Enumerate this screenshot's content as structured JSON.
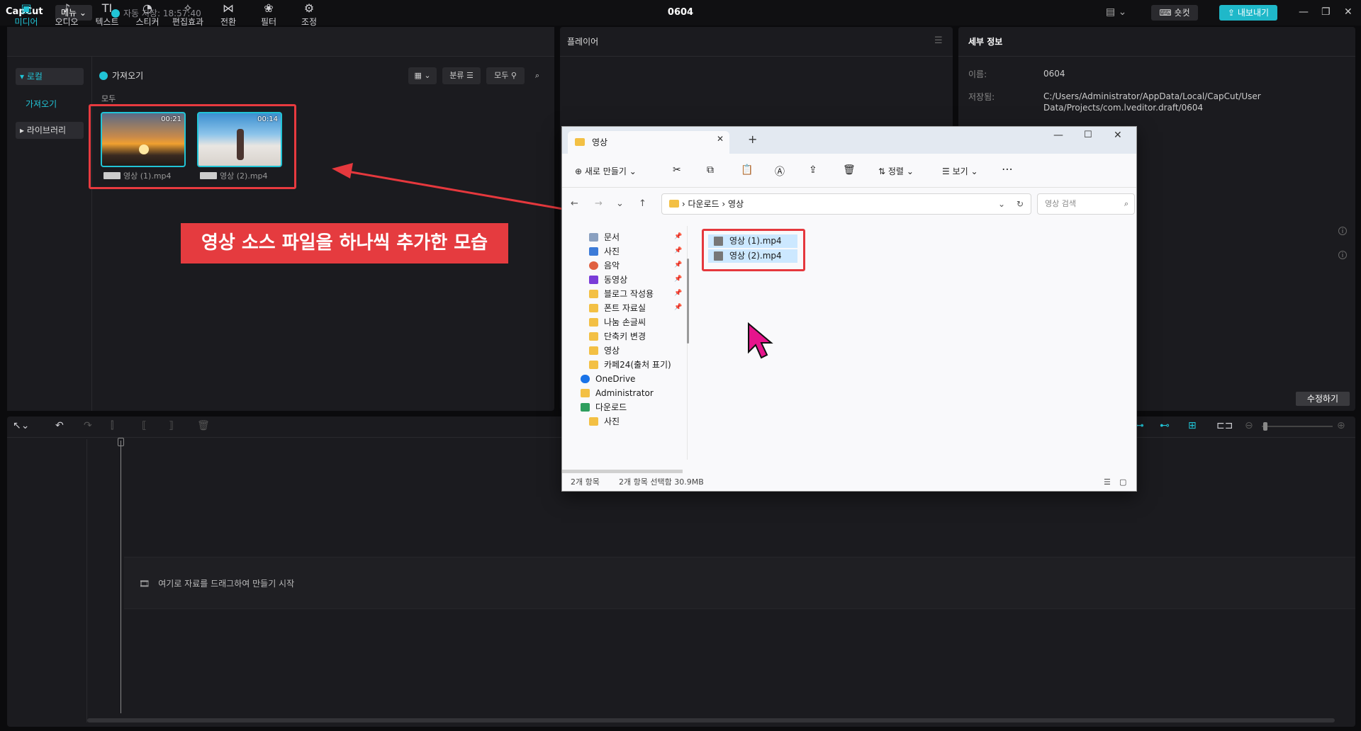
{
  "app": {
    "logo": "CapCut",
    "menu_label": "메뉴",
    "autosave": "자동 저장: 18:57:40",
    "project_title": "0604",
    "shortcut_label": "숏컷",
    "export_label": "내보내기",
    "accent": "#21c4d6"
  },
  "toolbar": {
    "items": [
      {
        "label": "미디어",
        "icon": "▣"
      },
      {
        "label": "오디오",
        "icon": "♪"
      },
      {
        "label": "텍스트",
        "icon": "TI"
      },
      {
        "label": "스티커",
        "icon": "◔"
      },
      {
        "label": "편집효과",
        "icon": "✧"
      },
      {
        "label": "전환",
        "icon": "⋈"
      },
      {
        "label": "필터",
        "icon": "❀"
      },
      {
        "label": "조정",
        "icon": "⚙"
      }
    ]
  },
  "sidebar": {
    "local": "▾ 로컬",
    "import": "가져오기",
    "library": "▸ 라이브러리"
  },
  "media": {
    "import_button": "가져오기",
    "sort_label": "분류",
    "filter_label": "모두",
    "all_label": "모두",
    "clips": [
      {
        "name": "영상 (1).mp4",
        "duration": "00:21"
      },
      {
        "name": "영상 (2).mp4",
        "duration": "00:14"
      }
    ],
    "banner": "영상 소스 파일을 하나씩 추가한 모습"
  },
  "player": {
    "title": "플레이어"
  },
  "details": {
    "title": "세부 정보",
    "name_label": "이름:",
    "name_value": "0604",
    "saved_label": "저장됨:",
    "saved_value": "C:/Users/Administrator/AppData/Local/CapCut/User Data/Projects/com.lveditor.draft/0604",
    "edit_button": "수정하기"
  },
  "timeline": {
    "drop_text": "여기로 자료를 드래그하여 만들기 시작"
  },
  "explorer": {
    "tab_title": "영상",
    "new_button": "새로 만들기",
    "sort_button": "정렬",
    "view_button": "보기",
    "breadcrumb": [
      "다운로드",
      "영상"
    ],
    "search_placeholder": "영상 검색",
    "tree": [
      {
        "label": "문서",
        "color": "#8aa0c0",
        "pinned": true
      },
      {
        "label": "사진",
        "color": "#3c7bd8",
        "pinned": true
      },
      {
        "label": "음악",
        "color": "#e06040",
        "pinned": true
      },
      {
        "label": "동영상",
        "color": "#7a3cd8",
        "pinned": true
      },
      {
        "label": "블로그 작성용",
        "color": "#f3c044",
        "pinned": true
      },
      {
        "label": "폰트 자료실",
        "color": "#f3c044",
        "pinned": true
      },
      {
        "label": "나눔 손글씨",
        "color": "#f3c044",
        "pinned": false
      },
      {
        "label": "단축키 변경",
        "color": "#f3c044",
        "pinned": false
      },
      {
        "label": "영상",
        "color": "#f3c044",
        "pinned": false
      },
      {
        "label": "카페24(출처 표기)",
        "color": "#f3c044",
        "pinned": false
      },
      {
        "label": "OneDrive",
        "color": "#1a73e8",
        "pinned": false
      },
      {
        "label": "Administrator",
        "color": "#f3c044",
        "pinned": false
      },
      {
        "label": "다운로드",
        "color": "#2e9e5e",
        "pinned": false
      },
      {
        "label": "사진",
        "color": "#f3c044",
        "pinned": false
      }
    ],
    "files": [
      "영상 (1).mp4",
      "영상 (2).mp4"
    ],
    "status_count": "2개 항목",
    "status_selected": "2개 항목 선택함 30.9MB"
  }
}
